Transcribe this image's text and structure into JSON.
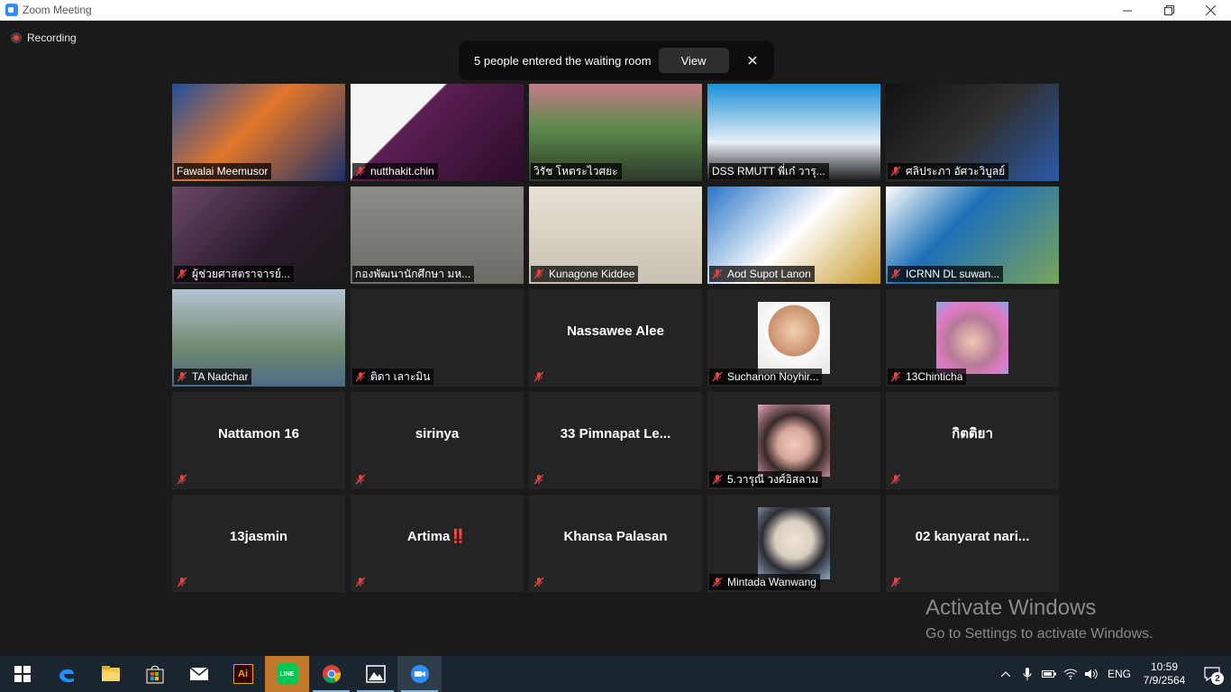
{
  "window": {
    "title": "Zoom Meeting"
  },
  "meeting": {
    "recording_label": "Recording",
    "waiting_room": {
      "text": "5 people entered the waiting room",
      "view_label": "View"
    }
  },
  "participants": [
    {
      "name": "Fawalai Meemusor",
      "muted": false,
      "video": true
    },
    {
      "name": "nutthakit.chin",
      "muted": true,
      "video": true
    },
    {
      "name": "วิรัช  โหตระไวศยะ",
      "muted": false,
      "video": true,
      "active": true
    },
    {
      "name": "DSS RMUTT พี่เก๋ วารุ...",
      "muted": false,
      "video": true
    },
    {
      "name": "ศลิประภา อัศวะวิบูลย์",
      "muted": true,
      "video": true
    },
    {
      "name": "ผู้ช่วยศาสตราจารย์...",
      "muted": true,
      "video": true
    },
    {
      "name": "กองพัฒนานักศึกษา มห...",
      "muted": false,
      "video": true
    },
    {
      "name": "Kunagone Kiddee",
      "muted": true,
      "video": true
    },
    {
      "name": "Aod Supot Lanon",
      "muted": true,
      "video": true
    },
    {
      "name": "ICRNN DL suwan...",
      "muted": true,
      "video": true
    },
    {
      "name": "TA Nadchar",
      "muted": true,
      "video": true
    },
    {
      "name": "ติดา เลาะมิน",
      "muted": true,
      "video": false
    },
    {
      "name": "Nassawee Alee",
      "muted": true,
      "video": false,
      "show_center": true,
      "hide_plate": true
    },
    {
      "name": "Suchanon Noyhir...",
      "muted": true,
      "video": false,
      "avatar": true
    },
    {
      "name": "13Chinticha",
      "muted": true,
      "video": false,
      "avatar": true
    },
    {
      "name": "Nattamon 16",
      "muted": true,
      "video": false,
      "show_center": true,
      "hide_plate": true
    },
    {
      "name": "sirinya",
      "muted": true,
      "video": false,
      "show_center": true,
      "hide_plate": true
    },
    {
      "name": "33 Pimnapat Le...",
      "muted": true,
      "video": false,
      "show_center": true,
      "hide_plate": true
    },
    {
      "name": "5.วารุณี วงศ์อิสลาม",
      "muted": true,
      "video": false,
      "avatar": true
    },
    {
      "name": "กิตติยา",
      "muted": true,
      "video": false,
      "show_center": true,
      "hide_plate": true
    },
    {
      "name": "13jasmin",
      "muted": true,
      "video": false,
      "show_center": true,
      "hide_plate": true
    },
    {
      "name": "Artima‼️",
      "muted": true,
      "video": false,
      "show_center": true,
      "hide_plate": true
    },
    {
      "name": "Khansa Palasan",
      "muted": true,
      "video": false,
      "show_center": true,
      "hide_plate": true
    },
    {
      "name": "Mintada Wanwang",
      "muted": true,
      "video": false,
      "avatar": true
    },
    {
      "name": "02 kanyarat nari...",
      "muted": true,
      "video": false,
      "show_center": true,
      "hide_plate": true
    }
  ],
  "watermark": {
    "line1": "Activate Windows",
    "line2": "Go to Settings to activate Windows."
  },
  "taskbar": {
    "apps": [
      "windows-start-icon",
      "edge-icon",
      "file-explorer-icon",
      "store-icon",
      "mail-icon",
      "illustrator-icon",
      "line-icon",
      "chrome-icon",
      "photos-icon",
      "zoom-icon"
    ],
    "illustrator_label": "Ai",
    "line_label": "LINE",
    "language": "ENG",
    "time": "10:59",
    "date": "7/9/2564",
    "notifications": "2"
  }
}
